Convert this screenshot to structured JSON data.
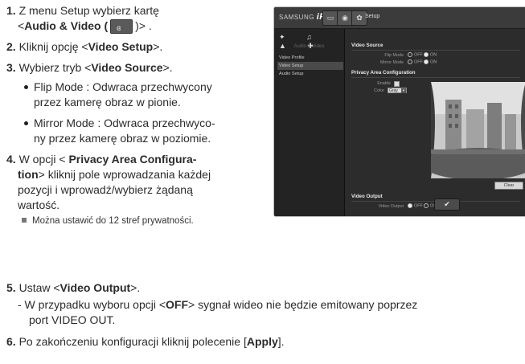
{
  "steps": {
    "s1": {
      "num": "1.",
      "pre": " Z menu Setup wybierz kartę",
      "line2_pre": "<",
      "line2_bold": "Audio & Video (",
      "line2_post": ")> ."
    },
    "s2": {
      "num": "2.",
      "pre": " Kliknij opcję <",
      "bold": "Video Setup",
      "post": ">."
    },
    "s3": {
      "num": "3.",
      "pre": " Wybierz tryb <",
      "bold": "Video Source",
      "post": ">."
    },
    "b1": {
      "l1": "Flip Mode : Odwraca przechwycony",
      "l2": "przez kamerę obraz w pionie."
    },
    "b2": {
      "l1": "Mirror Mode : Odwraca przechwyco-",
      "l2": "ny przez kamerę obraz w poziomie."
    },
    "s4": {
      "num": "4.",
      "pre": " W opcji < ",
      "bold1": "Privacy Area Configura-",
      "bold2": "tion",
      "post2": "> kliknij pole wprowadzania każdej",
      "l3": "pozycji i wprowadź/wybierz żądaną",
      "l4": "wartość."
    },
    "note": "Można ustawić do 12 stref prywatności.",
    "s5": {
      "num": "5.",
      "pre": " Ustaw <",
      "bold": "Video Output",
      "post": ">."
    },
    "dash": {
      "pre": "- W przypadku wyboru opcji <",
      "bold": "OFF",
      "post": "> sygnał wideo nie będzie emitowany poprzez",
      "l2": "port VIDEO OUT."
    },
    "s6": {
      "num": "6.",
      "pre": " Po zakończeniu konfiguracji kliknij polecenie [",
      "bold": "Apply",
      "post": "]."
    }
  },
  "screenshot": {
    "brand_small": "SAMSUNG",
    "brand_big": "iPOLiS",
    "top_label": "Setup",
    "side_title": "Audio & Video",
    "side_items": [
      "Video Profile",
      "Video Setup",
      "Audio Setup"
    ],
    "video_source": "Video Source",
    "flip_label": "Flip Mode",
    "mirror_label": "Mirror Mode",
    "off": "OFF",
    "on": "ON",
    "privacy": "Privacy Area Configuration",
    "enable": "Enable",
    "color": "Color",
    "color_value": "Gray",
    "clear": "Clear",
    "video_output": "Video Output",
    "video_output_label": "Video Output",
    "apply_icon": "✔"
  },
  "icons": {
    "av_icon": "speaker-camera-icon"
  }
}
